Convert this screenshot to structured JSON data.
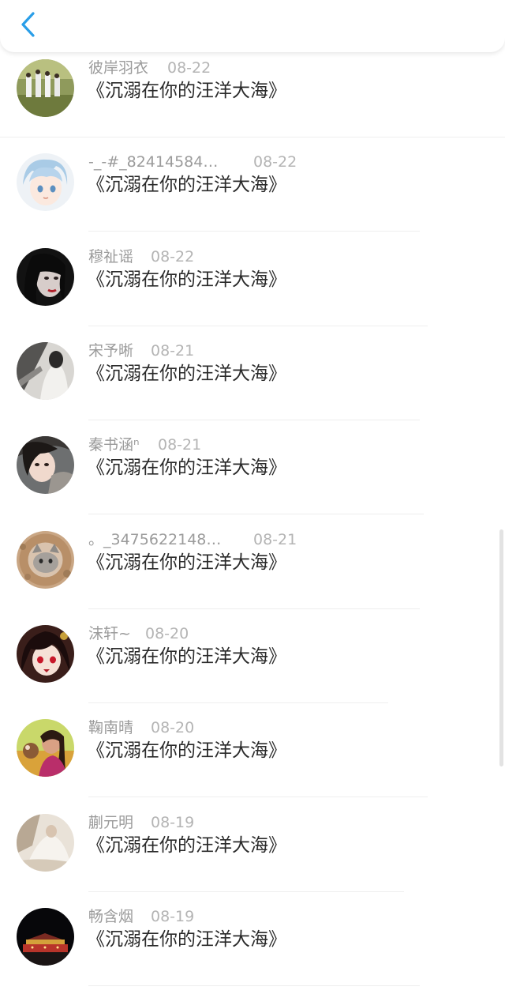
{
  "header": {
    "back_icon": "chevron-left-icon",
    "accent": "#2a9ee8"
  },
  "list": {
    "items": [
      {
        "name": "彼岸羽衣",
        "date": "08-22",
        "title": "《沉溺在你的汪洋大海》"
      },
      {
        "name": "-_-#_82414584…",
        "date": "08-22",
        "title": "《沉溺在你的汪洋大海》"
      },
      {
        "name": "穆祉谣",
        "date": "08-22",
        "title": "《沉溺在你的汪洋大海》"
      },
      {
        "name": "宋予晰",
        "date": "08-21",
        "title": "《沉溺在你的汪洋大海》"
      },
      {
        "name": "秦书涵ⁿ",
        "date": "08-21",
        "title": "《沉溺在你的汪洋大海》"
      },
      {
        "name": "。_3475622148…",
        "date": "08-21",
        "title": "《沉溺在你的汪洋大海》"
      },
      {
        "name": "沫轩~",
        "date": "08-20",
        "title": "《沉溺在你的汪洋大海》"
      },
      {
        "name": "鞠南晴",
        "date": "08-20",
        "title": "《沉溺在你的汪洋大海》"
      },
      {
        "name": "蒯元明",
        "date": "08-19",
        "title": "《沉溺在你的汪洋大海》"
      },
      {
        "name": "畅含烟",
        "date": "08-19",
        "title": "《沉溺在你的汪洋大海》"
      }
    ]
  }
}
